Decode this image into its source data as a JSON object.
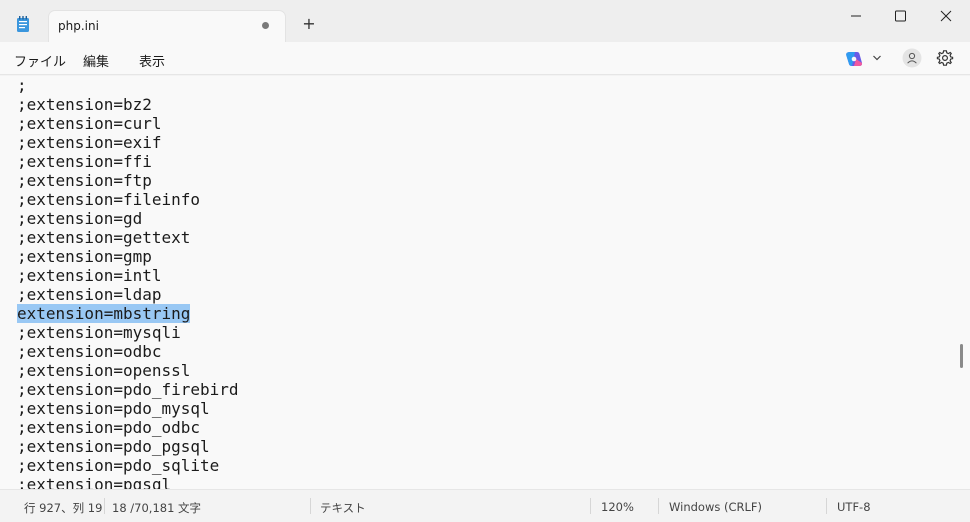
{
  "tab": {
    "title": "php.ini",
    "unsaved_indicator": "•",
    "new_tab_glyph": "+"
  },
  "menu": {
    "file": "ファイル",
    "edit": "編集",
    "view": "表示"
  },
  "editor": {
    "lines": [
      ";",
      ";extension=bz2",
      ";extension=curl",
      ";extension=exif",
      ";extension=ffi",
      ";extension=ftp",
      ";extension=fileinfo",
      ";extension=gd",
      ";extension=gettext",
      ";extension=gmp",
      ";extension=intl",
      ";extension=ldap",
      "extension=mbstring",
      ";extension=mysqli",
      ";extension=odbc",
      ";extension=openssl",
      ";extension=pdo_firebird",
      ";extension=pdo_mysql",
      ";extension=pdo_odbc",
      ";extension=pdo_pgsql",
      ";extension=pdo_sqlite",
      ";extension=pgsql"
    ],
    "selected_line_index": 12
  },
  "status": {
    "position": "行 927、列 19",
    "selection": "18 /70,181 文字",
    "format": "テキスト",
    "zoom": "120%",
    "line_ending": "Windows (CRLF)",
    "encoding": "UTF-8"
  },
  "icons": {
    "app": "notepad-icon",
    "copilot": "copilot-icon",
    "account": "account-icon",
    "settings": "gear-icon"
  },
  "colors": {
    "selection": "#99c8f4",
    "background": "#f9f9f9"
  }
}
